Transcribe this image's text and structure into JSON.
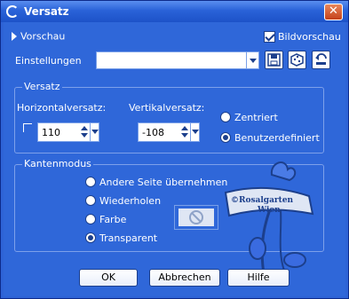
{
  "window": {
    "title": "Versatz",
    "close_glyph": "✕"
  },
  "top": {
    "preview_label": "Vorschau",
    "bildvorschau_label": "Bildvorschau",
    "bildvorschau_checked": true
  },
  "settings": {
    "label": "Einstellungen",
    "value": ""
  },
  "versatz": {
    "title": "Versatz",
    "horizontal_label": "Horizontalversatz:",
    "horizontal_value": "110",
    "vertical_label": "Vertikalversatz:",
    "vertical_value": "-108",
    "link_checked": false,
    "radio_centered": "Zentriert",
    "radio_custom": "Benutzerdefiniert",
    "selected": "Benutzerdefiniert"
  },
  "kantenmodus": {
    "title": "Kantenmodus",
    "options": [
      "Andere Seite übernehmen",
      "Wiederholen",
      "Farbe",
      "Transparent"
    ],
    "selected": "Transparent"
  },
  "buttons": {
    "ok": "OK",
    "cancel": "Abbrechen",
    "help": "Hilfe"
  },
  "watermark": {
    "line1": "©Rosalgarten",
    "line2": "Wien"
  },
  "icons": [
    "dialog-app-icon",
    "save-preset-icon",
    "randomize-icon",
    "reset-icon",
    "no-color-icon",
    "close-icon"
  ],
  "colors": {
    "client": "#2f67d9",
    "titlebar": "#2a62d8",
    "close": "#d0522a"
  }
}
